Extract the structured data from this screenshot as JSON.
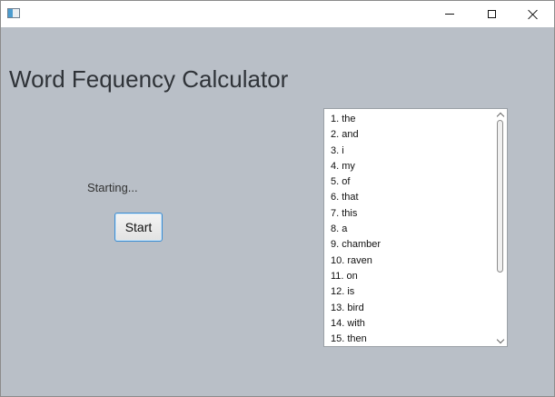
{
  "window": {
    "icon": "java-app-icon",
    "controls": {
      "minimize_icon": "minimize-icon",
      "maximize_icon": "maximize-icon",
      "close_icon": "close-icon"
    }
  },
  "main": {
    "title": "Word Fequency Calculator",
    "status": "Starting...",
    "start_label": "Start"
  },
  "word_list": {
    "items": [
      "1. the",
      "2. and",
      "3. i",
      "4. my",
      "5. of",
      "6. that",
      "7. this",
      "8. a",
      "9. chamber",
      "10. raven",
      "11. on",
      "12. is",
      "13. bird",
      "14. with",
      "15. then"
    ]
  },
  "colors": {
    "background": "#b9bfc7",
    "focus_accent": "#3c8ed3"
  }
}
